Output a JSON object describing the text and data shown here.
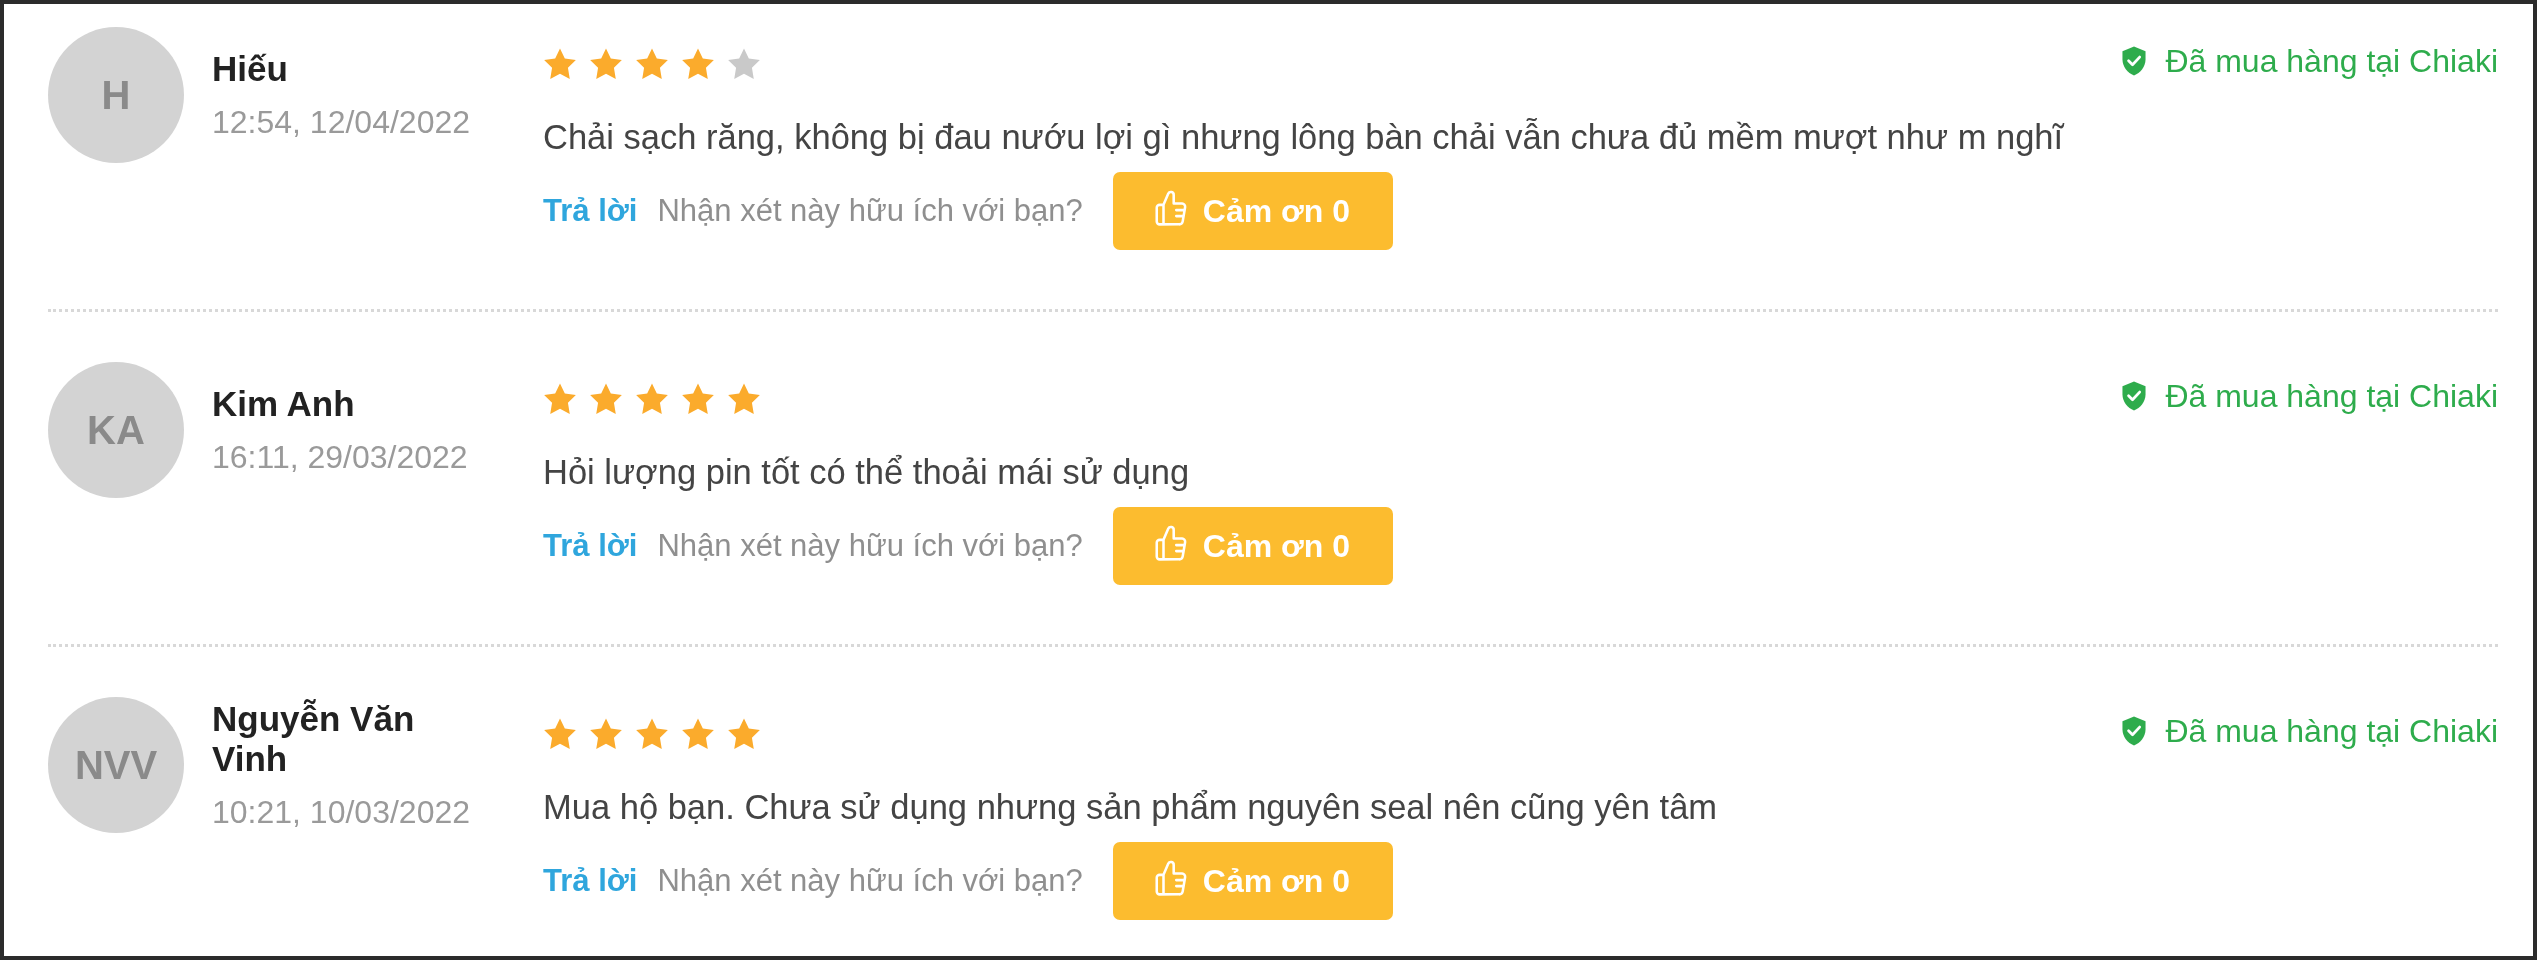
{
  "reviews": [
    {
      "avatar": "H",
      "name": "Hiếu",
      "time": "12:54, 12/04/2022",
      "stars": 4,
      "comment": "Chải sạch răng, không bị đau nướu lợi gì nhưng lông bàn chải vẫn chưa đủ mềm mượt như m nghĩ",
      "reply": "Trả lời",
      "helpful_question": "Nhận xét này hữu ích với bạn?",
      "thanks": "Cảm ơn 0",
      "verified": "Đã mua hàng tại Chiaki"
    },
    {
      "avatar": "KA",
      "name": "Kim Anh",
      "time": "16:11, 29/03/2022",
      "stars": 5,
      "comment": "Hỏi lượng pin tốt có thể thoải mái sử dụng",
      "reply": "Trả lời",
      "helpful_question": "Nhận xét này hữu ích với bạn?",
      "thanks": "Cảm ơn 0",
      "verified": "Đã mua hàng tại Chiaki"
    },
    {
      "avatar": "NVV",
      "name": "Nguyễn Văn Vinh",
      "time": "10:21, 10/03/2022",
      "stars": 5,
      "comment": "Mua hộ bạn. Chưa sử dụng nhưng sản phẩm nguyên seal nên cũng yên tâm",
      "reply": "Trả lời",
      "helpful_question": "Nhận xét này hữu ích với bạn?",
      "thanks": "Cảm ơn 0",
      "verified": "Đã mua hàng tại Chiaki"
    }
  ]
}
